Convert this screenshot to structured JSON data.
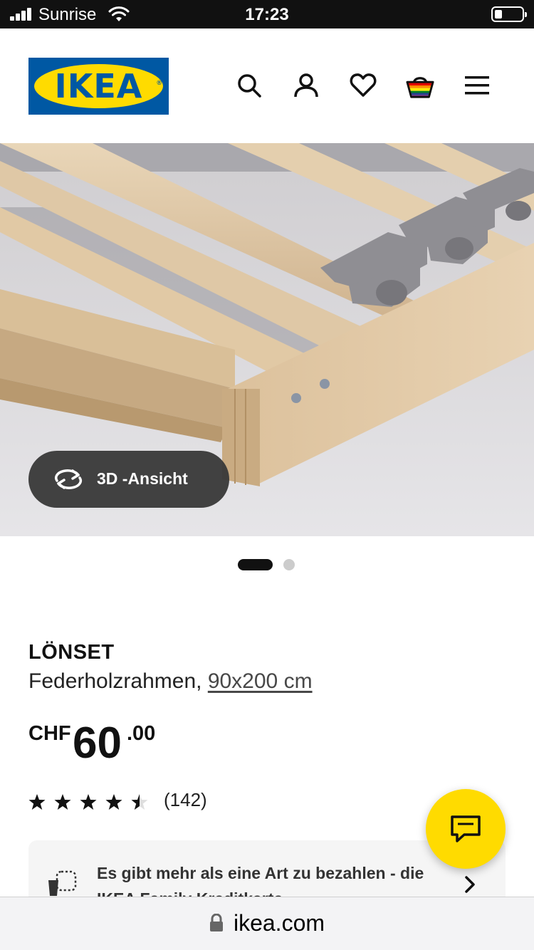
{
  "status_bar": {
    "carrier": "Sunrise",
    "time": "17:23"
  },
  "header": {
    "logo_text": "IKEA",
    "icons": [
      "search-icon",
      "account-icon",
      "wishlist-heart-icon",
      "shopping-basket-icon",
      "menu-hamburger-icon"
    ]
  },
  "hero": {
    "view3d_label": "3D -Ansicht",
    "image_count": 2,
    "active_image": 1
  },
  "product": {
    "name": "LÖNSET",
    "description": "Federholzrahmen,",
    "size": "90x200 cm",
    "price": {
      "currency": "CHF",
      "integer": "60",
      "decimals": ".00"
    },
    "rating": {
      "stars": 4.5,
      "max": 5,
      "count_label": "(142)"
    }
  },
  "info_card": {
    "text": "Es gibt mehr als eine Art zu bezahlen - die IKEA Family Kreditkarte"
  },
  "browser": {
    "url": "ikea.com"
  },
  "colors": {
    "ikea_blue": "#0058a3",
    "ikea_yellow": "#ffdb00",
    "pill_bg": "#383838"
  }
}
